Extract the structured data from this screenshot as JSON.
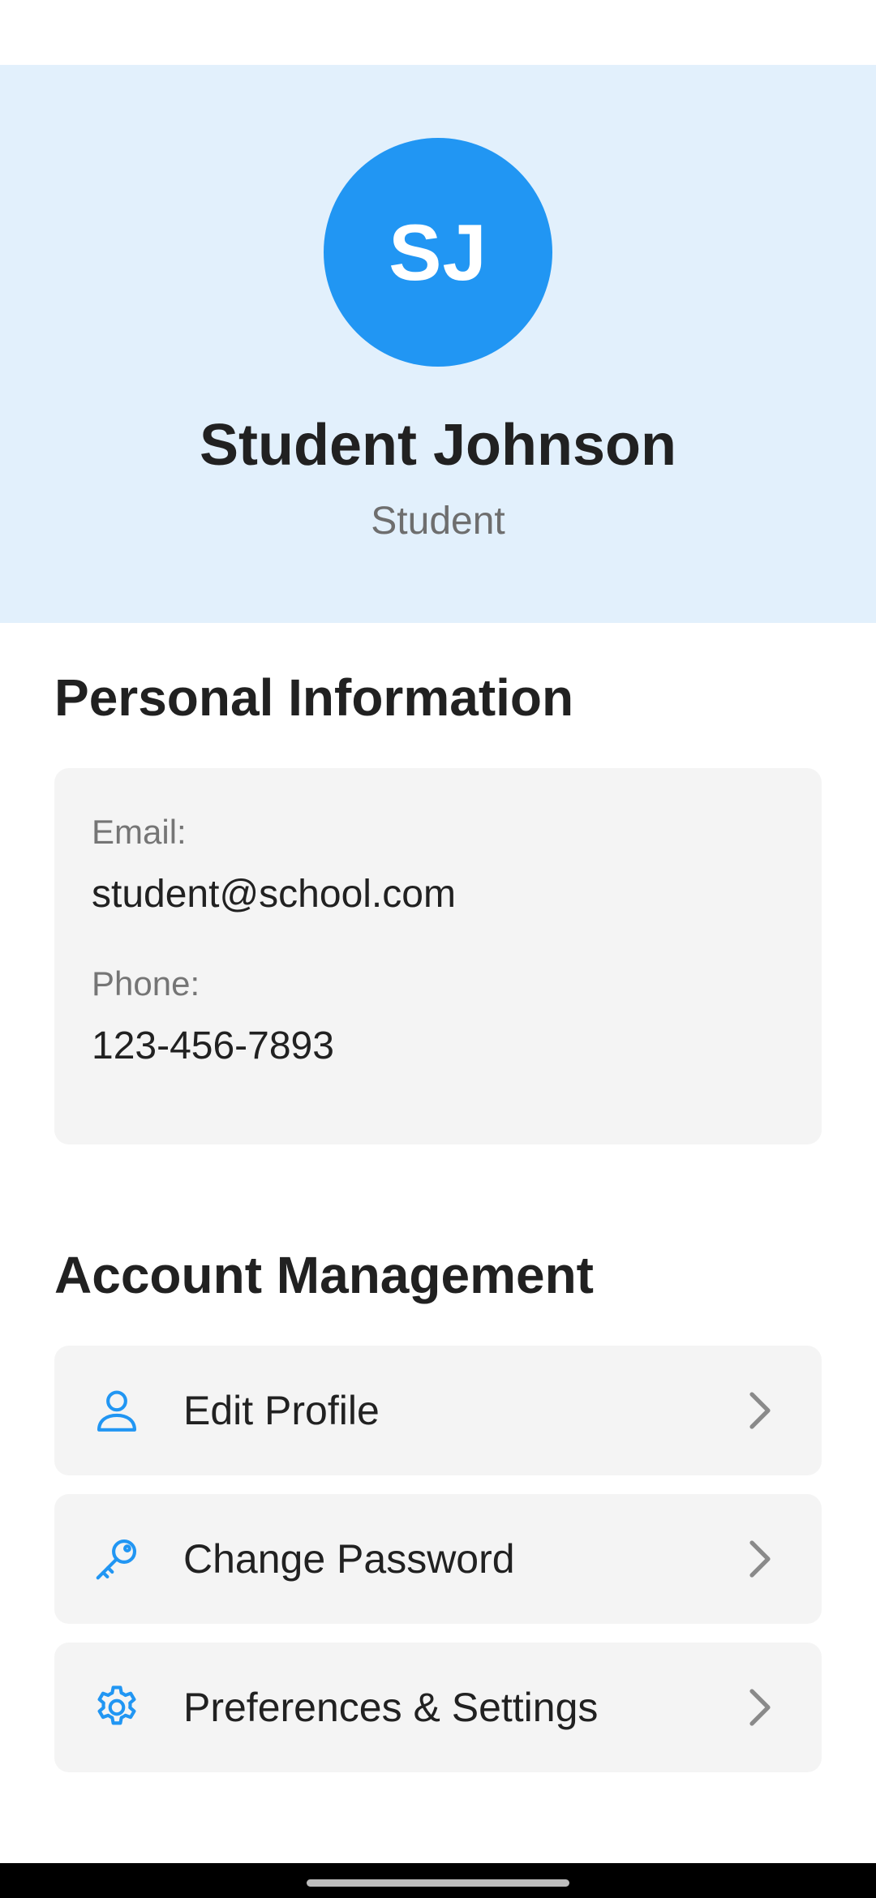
{
  "profile": {
    "initials": "SJ",
    "name": "Student Johnson",
    "role": "Student",
    "avatar_color": "#2196F3",
    "header_background": "#E2F0FC"
  },
  "personal_info": {
    "section_title": "Personal Information",
    "email_label": "Email:",
    "email_value": "student@school.com",
    "phone_label": "Phone:",
    "phone_value": "123-456-7893"
  },
  "account_management": {
    "section_title": "Account Management",
    "items": [
      {
        "label": "Edit Profile",
        "icon": "person-icon"
      },
      {
        "label": "Change Password",
        "icon": "key-icon"
      },
      {
        "label": "Preferences & Settings",
        "icon": "gear-icon"
      }
    ],
    "icon_color": "#2196F3",
    "chevron_icon": "chevron-right-icon"
  }
}
